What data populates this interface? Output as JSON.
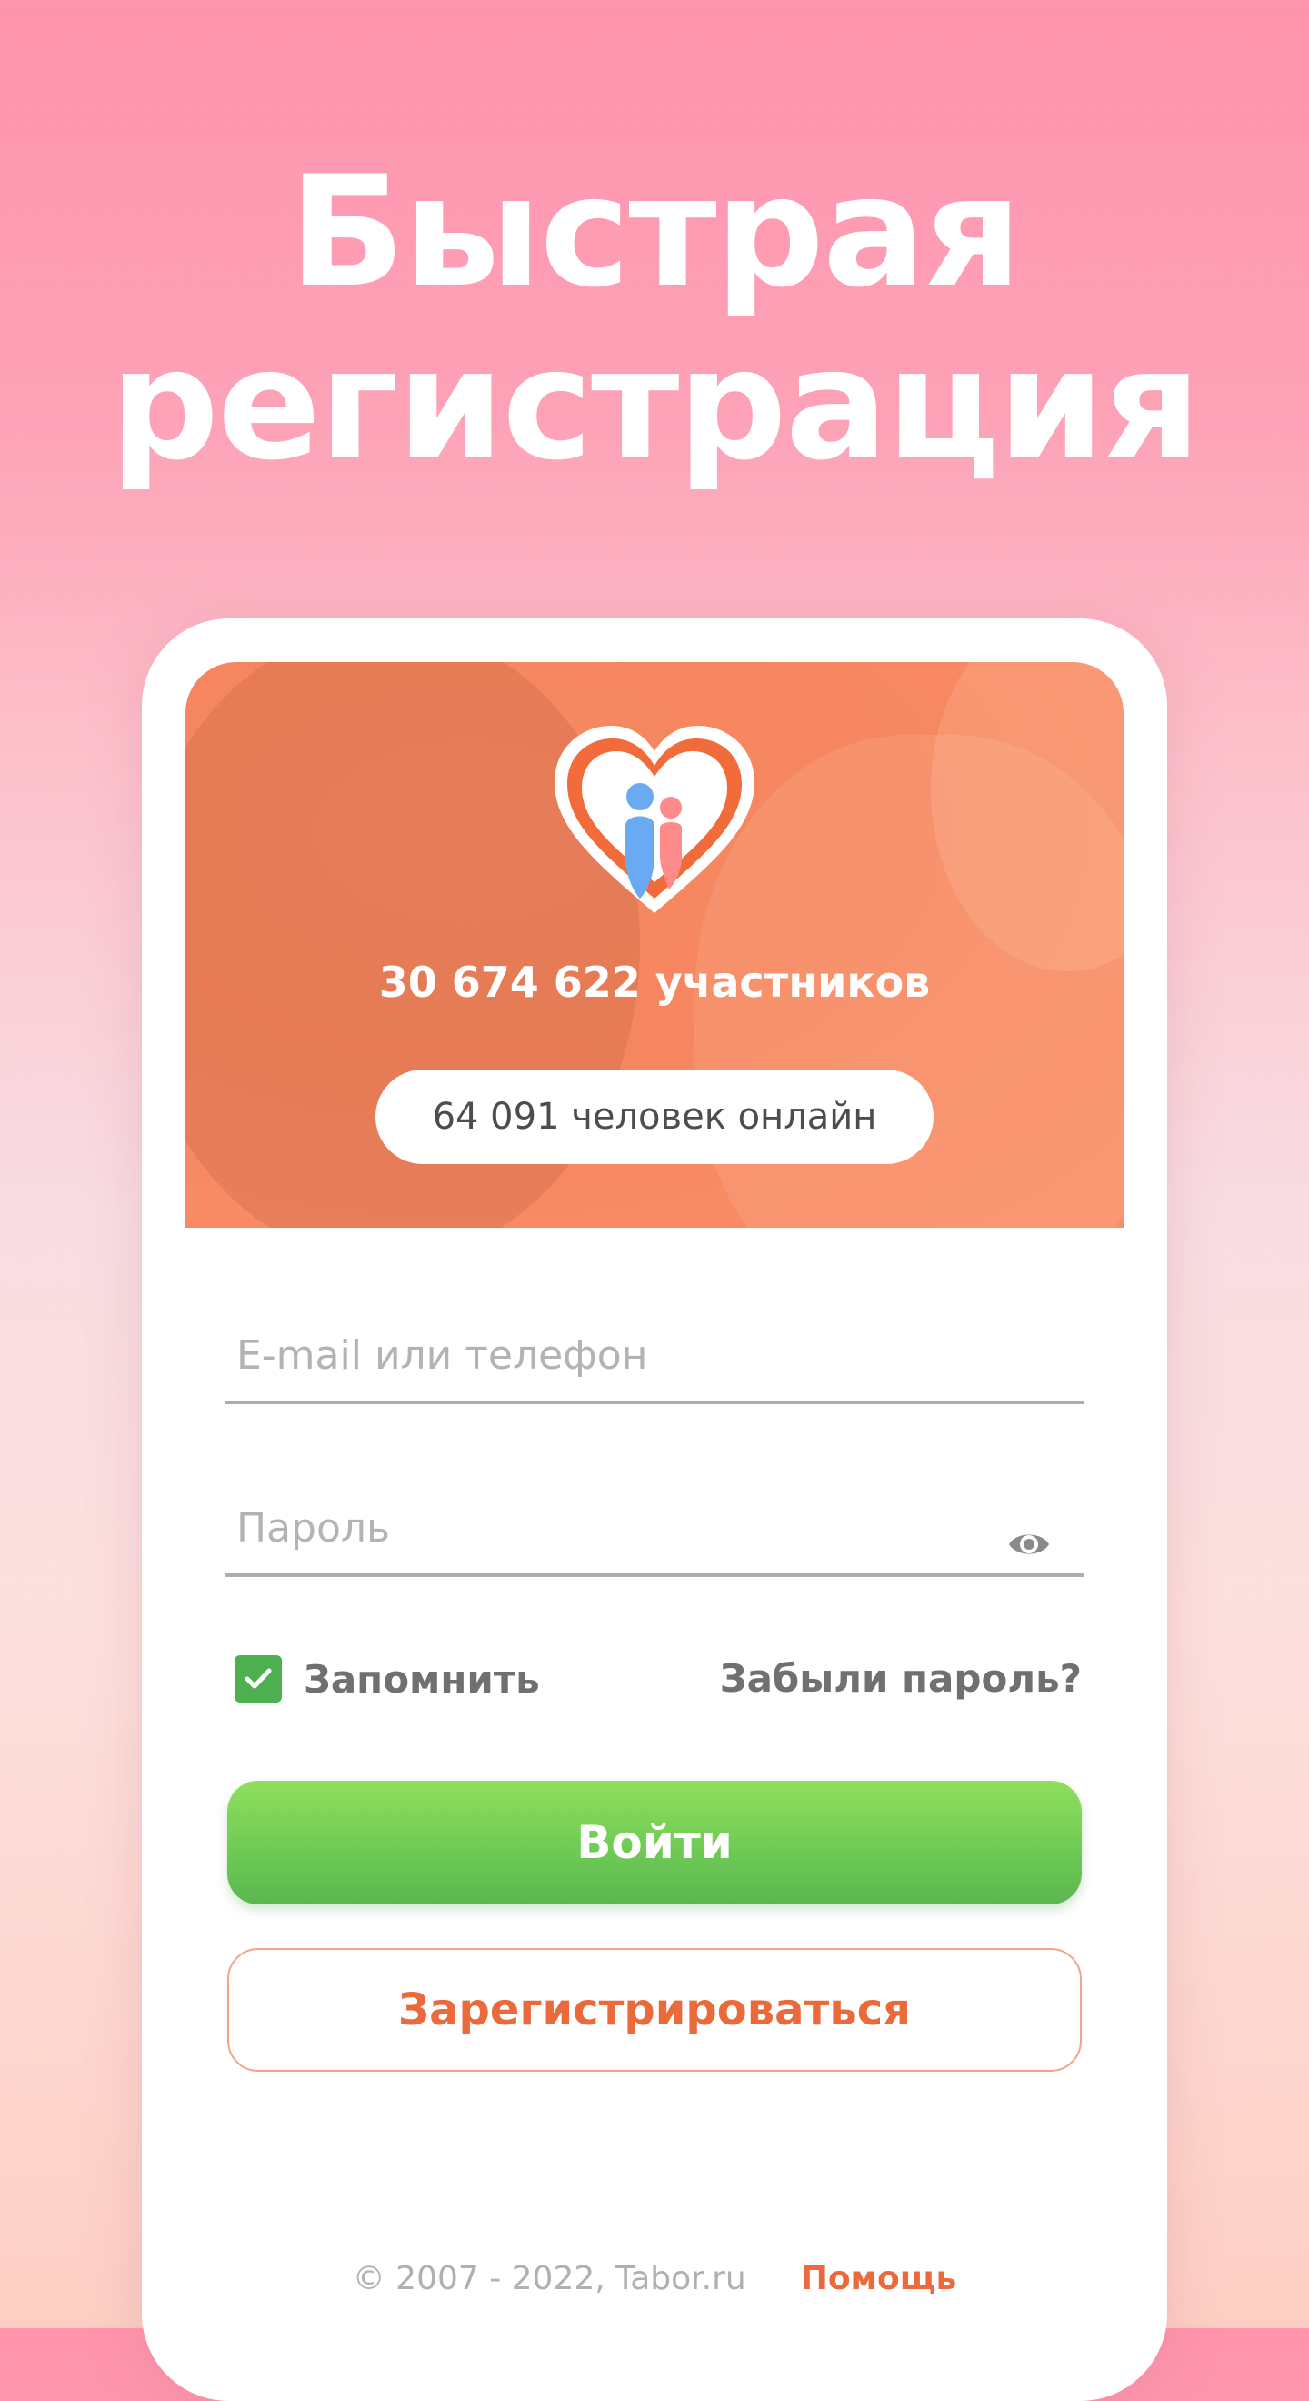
{
  "headline": {
    "line1": "Быстрая",
    "line2": "регистрация"
  },
  "hero": {
    "members_text": "30 674 622 участников",
    "online_text": "64 091 человек онлайн",
    "logo_icon": "heart-couple-logo"
  },
  "form": {
    "email_placeholder": "E-mail или телефон",
    "password_placeholder": "Пароль",
    "show_password_icon": "eye-icon",
    "remember_label": "Запомнить",
    "remember_checked": true,
    "forgot_label": "Забыли пароль?",
    "login_label": "Войти",
    "register_label": "Зарегистрироваться"
  },
  "footer": {
    "copyright": "© 2007 - 2022, Tabor.ru",
    "help_label": "Помощь"
  },
  "colors": {
    "accent_orange": "#ea6a3c",
    "login_green": "#6fcb55",
    "checkbox_green": "#4caf50",
    "hero_orange": "#f6865f"
  }
}
